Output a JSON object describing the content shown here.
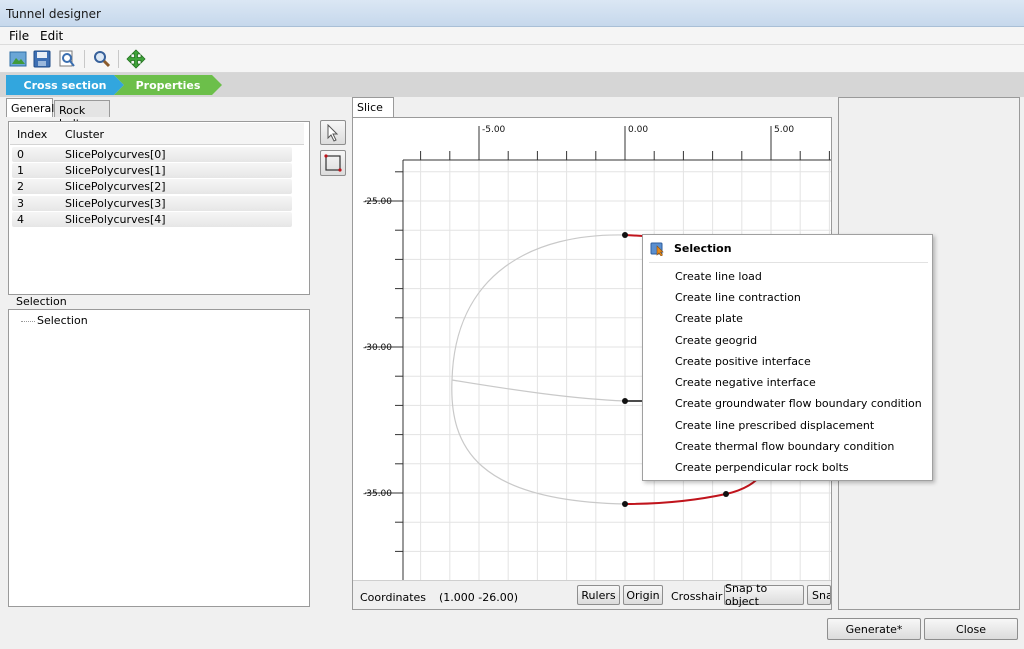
{
  "window": {
    "title": "Tunnel designer"
  },
  "menu": {
    "file": "File",
    "edit": "Edit"
  },
  "wizard": {
    "step1": "Cross section",
    "step2": "Properties"
  },
  "left_tabs": {
    "general": "General",
    "rock_bolts": "Rock bolts"
  },
  "cluster_table": {
    "headers": {
      "index": "Index",
      "cluster": "Cluster"
    },
    "rows": [
      {
        "index": "0",
        "cluster": "SlicePolycurves[0]"
      },
      {
        "index": "1",
        "cluster": "SlicePolycurves[1]"
      },
      {
        "index": "2",
        "cluster": "SlicePolycurves[2]"
      },
      {
        "index": "3",
        "cluster": "SlicePolycurves[3]"
      },
      {
        "index": "4",
        "cluster": "SlicePolycurves[4]"
      }
    ]
  },
  "selection_panel": {
    "title": "Selection",
    "tree_item": "Selection"
  },
  "slice_tab": "Slice",
  "ruler": {
    "x_labels": [
      "-5.00",
      "0.00",
      "5.00"
    ],
    "y_labels": [
      "-25.00",
      "-30.00",
      "-35.00"
    ]
  },
  "status": {
    "coordinates_label": "Coordinates",
    "coordinates_value": "(1.000 -26.00)",
    "rulers": "Rulers",
    "origin": "Origin",
    "crosshair": "Crosshair",
    "snap_to_object": "Snap to object",
    "snap_more": "Sna"
  },
  "context_menu": {
    "title": "Selection",
    "items": [
      "Create line load",
      "Create line contraction",
      "Create plate",
      "Create geogrid",
      "Create positive interface",
      "Create negative interface",
      "Create groundwater flow boundary condition",
      "Create line prescribed displacement",
      "Create thermal flow boundary condition",
      "Create perpendicular rock bolts"
    ]
  },
  "footer": {
    "generate": "Generate*",
    "close": "Close"
  },
  "icons": [
    "open-icon",
    "save-icon",
    "zoom-page-icon",
    "magnifier-icon",
    "move-icon",
    "pointer-icon",
    "select-rect-icon",
    "selection-menu-icon"
  ],
  "colors": {
    "accent_blue": "#32a6de",
    "accent_green": "#6cbf4a",
    "highlight_curve": "#c0141c",
    "grid": "#e3e3e3"
  }
}
